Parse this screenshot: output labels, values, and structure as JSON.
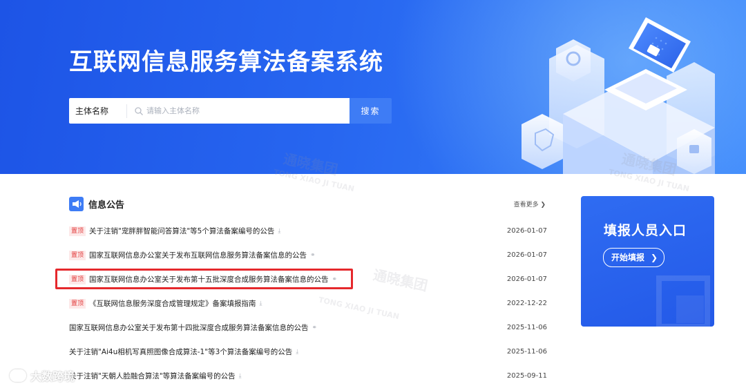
{
  "header": {
    "title": "互联网信息服务算法备案系统"
  },
  "search": {
    "type_label": "主体名称",
    "placeholder": "请输入主体名称",
    "button_label": "搜索"
  },
  "notices": {
    "section_title": "信息公告",
    "view_more": "查看更多",
    "pin_label": "置顶",
    "items": [
      {
        "title": "关于注销\"宠胖胖智能问答算法\"等5个算法备案编号的公告",
        "date": "2026-01-07",
        "pinned": true,
        "icon": "download-icon"
      },
      {
        "title": "国家互联网信息办公室关于发布互联网信息服务算法备案信息的公告",
        "date": "2026-01-07",
        "pinned": true,
        "icon": "link-icon"
      },
      {
        "title": "国家互联网信息办公室关于发布第十五批深度合成服务算法备案信息的公告",
        "date": "2026-01-07",
        "pinned": true,
        "icon": "link-icon"
      },
      {
        "title": "《互联网信息服务深度合成管理规定》备案填报指南",
        "date": "2022-12-22",
        "pinned": true,
        "icon": "download-icon"
      },
      {
        "title": "国家互联网信息办公室关于发布第十四批深度合成服务算法备案信息的公告",
        "date": "2025-11-06",
        "pinned": false,
        "icon": "link-icon"
      },
      {
        "title": "关于注销\"Ai4u相机写真照图像合成算法-1\"等3个算法备案编号的公告",
        "date": "2025-11-06",
        "pinned": false,
        "icon": "download-icon"
      },
      {
        "title": "关于注销\"天朝人脸融合算法\"等算法备案编号的公告",
        "date": "2025-09-11",
        "pinned": false,
        "icon": "download-icon"
      }
    ]
  },
  "entry_card": {
    "title": "填报人员入口",
    "button_label": "开始填报"
  },
  "watermark": {
    "brand": "通晓集团",
    "brand_pinyin": "TONG XIAO JI TUAN",
    "corner_label": "大数跨境"
  },
  "colors": {
    "banner_blue": "#2766f0",
    "accent_blue": "#3e7cf5",
    "pin_red": "#e23b3b",
    "highlight_red": "#e5282c"
  }
}
